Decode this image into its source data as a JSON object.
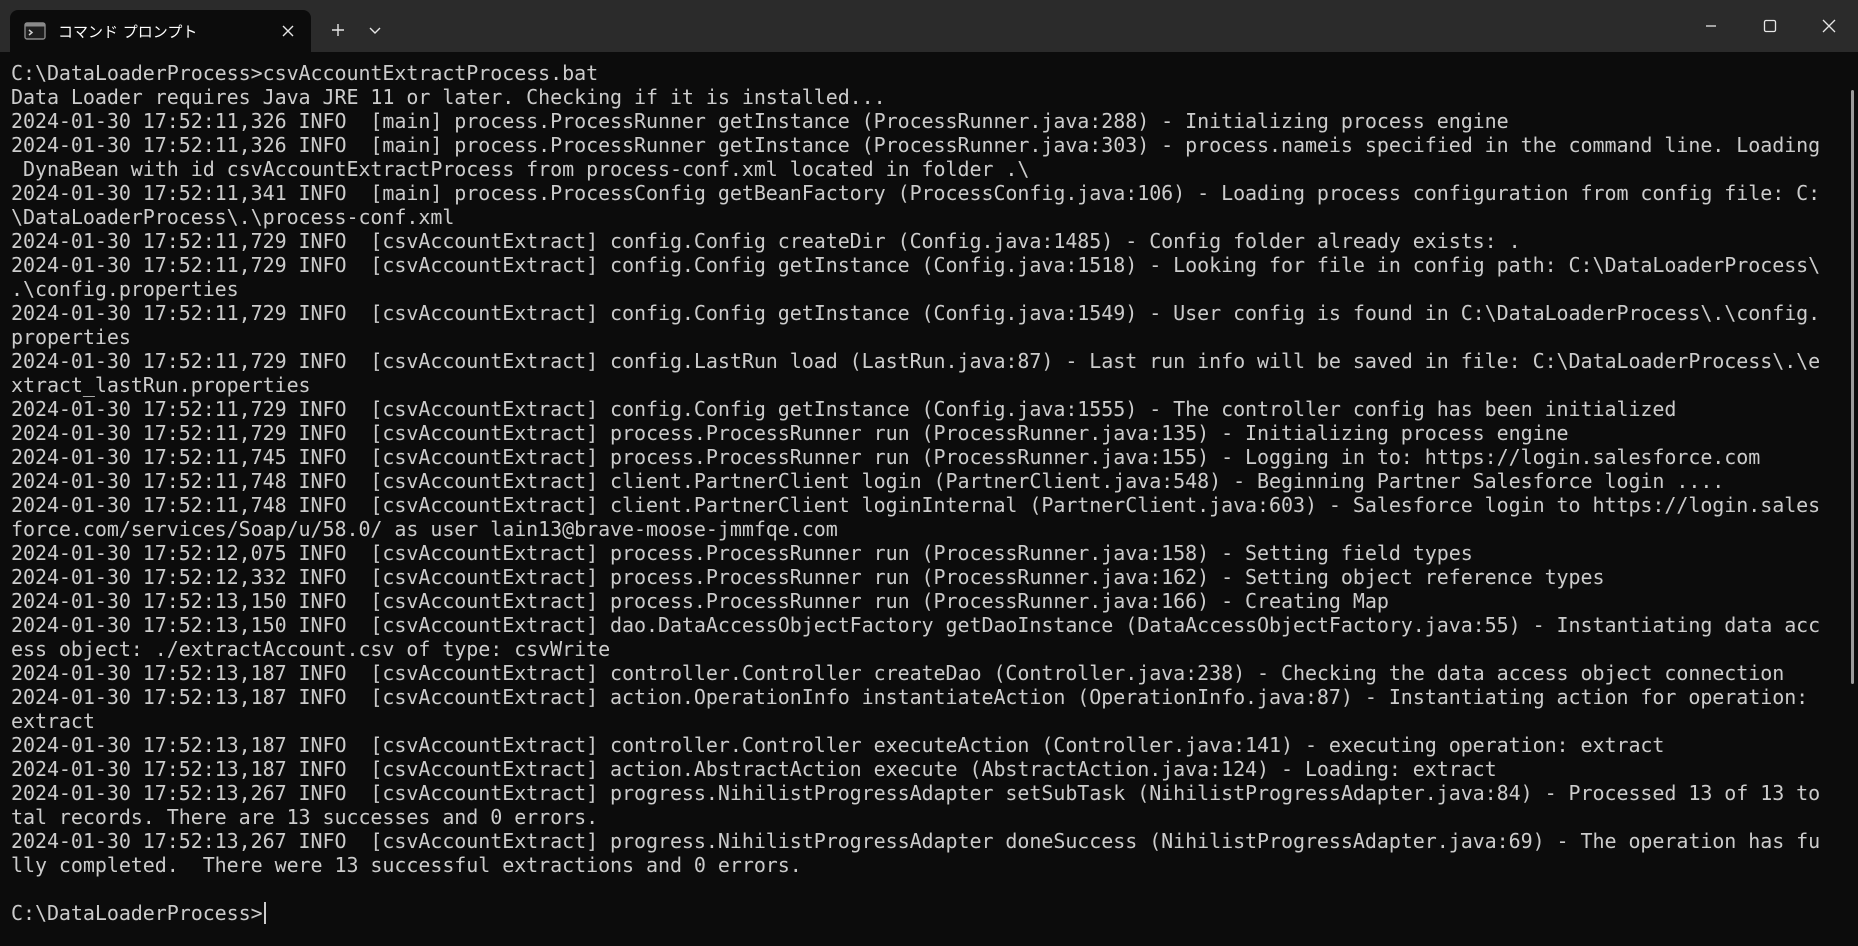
{
  "window": {
    "tab_title": "コマンド プロンプト"
  },
  "terminal": {
    "lines": [
      "C:\\DataLoaderProcess>csvAccountExtractProcess.bat",
      "Data Loader requires Java JRE 11 or later. Checking if it is installed...",
      "2024-01-30 17:52:11,326 INFO  [main] process.ProcessRunner getInstance (ProcessRunner.java:288) - Initializing process engine",
      "2024-01-30 17:52:11,326 INFO  [main] process.ProcessRunner getInstance (ProcessRunner.java:303) - process.nameis specified in the command line. Loading",
      " DynaBean with id csvAccountExtractProcess from process-conf.xml located in folder .\\",
      "2024-01-30 17:52:11,341 INFO  [main] process.ProcessConfig getBeanFactory (ProcessConfig.java:106) - Loading process configuration from config file: C:",
      "\\DataLoaderProcess\\.\\process-conf.xml",
      "2024-01-30 17:52:11,729 INFO  [csvAccountExtract] config.Config createDir (Config.java:1485) - Config folder already exists: .",
      "2024-01-30 17:52:11,729 INFO  [csvAccountExtract] config.Config getInstance (Config.java:1518) - Looking for file in config path: C:\\DataLoaderProcess\\",
      ".\\config.properties",
      "2024-01-30 17:52:11,729 INFO  [csvAccountExtract] config.Config getInstance (Config.java:1549) - User config is found in C:\\DataLoaderProcess\\.\\config.",
      "properties",
      "2024-01-30 17:52:11,729 INFO  [csvAccountExtract] config.LastRun load (LastRun.java:87) - Last run info will be saved in file: C:\\DataLoaderProcess\\.\\e",
      "xtract_lastRun.properties",
      "2024-01-30 17:52:11,729 INFO  [csvAccountExtract] config.Config getInstance (Config.java:1555) - The controller config has been initialized",
      "2024-01-30 17:52:11,729 INFO  [csvAccountExtract] process.ProcessRunner run (ProcessRunner.java:135) - Initializing process engine",
      "2024-01-30 17:52:11,745 INFO  [csvAccountExtract] process.ProcessRunner run (ProcessRunner.java:155) - Logging in to: https://login.salesforce.com",
      "2024-01-30 17:52:11,748 INFO  [csvAccountExtract] client.PartnerClient login (PartnerClient.java:548) - Beginning Partner Salesforce login ....",
      "2024-01-30 17:52:11,748 INFO  [csvAccountExtract] client.PartnerClient loginInternal (PartnerClient.java:603) - Salesforce login to https://login.sales",
      "force.com/services/Soap/u/58.0/ as user lain13@brave-moose-jmmfqe.com",
      "2024-01-30 17:52:12,075 INFO  [csvAccountExtract] process.ProcessRunner run (ProcessRunner.java:158) - Setting field types",
      "2024-01-30 17:52:12,332 INFO  [csvAccountExtract] process.ProcessRunner run (ProcessRunner.java:162) - Setting object reference types",
      "2024-01-30 17:52:13,150 INFO  [csvAccountExtract] process.ProcessRunner run (ProcessRunner.java:166) - Creating Map",
      "2024-01-30 17:52:13,150 INFO  [csvAccountExtract] dao.DataAccessObjectFactory getDaoInstance (DataAccessObjectFactory.java:55) - Instantiating data acc",
      "ess object: ./extractAccount.csv of type: csvWrite",
      "2024-01-30 17:52:13,187 INFO  [csvAccountExtract] controller.Controller createDao (Controller.java:238) - Checking the data access object connection",
      "2024-01-30 17:52:13,187 INFO  [csvAccountExtract] action.OperationInfo instantiateAction (OperationInfo.java:87) - Instantiating action for operation:",
      "extract",
      "2024-01-30 17:52:13,187 INFO  [csvAccountExtract] controller.Controller executeAction (Controller.java:141) - executing operation: extract",
      "2024-01-30 17:52:13,187 INFO  [csvAccountExtract] action.AbstractAction execute (AbstractAction.java:124) - Loading: extract",
      "2024-01-30 17:52:13,267 INFO  [csvAccountExtract] progress.NihilistProgressAdapter setSubTask (NihilistProgressAdapter.java:84) - Processed 13 of 13 to",
      "tal records. There are 13 successes and 0 errors.",
      "2024-01-30 17:52:13,267 INFO  [csvAccountExtract] progress.NihilistProgressAdapter doneSuccess (NihilistProgressAdapter.java:69) - The operation has fu",
      "lly completed.  There were 13 successful extractions and 0 errors.",
      "",
      "C:\\DataLoaderProcess>"
    ]
  }
}
